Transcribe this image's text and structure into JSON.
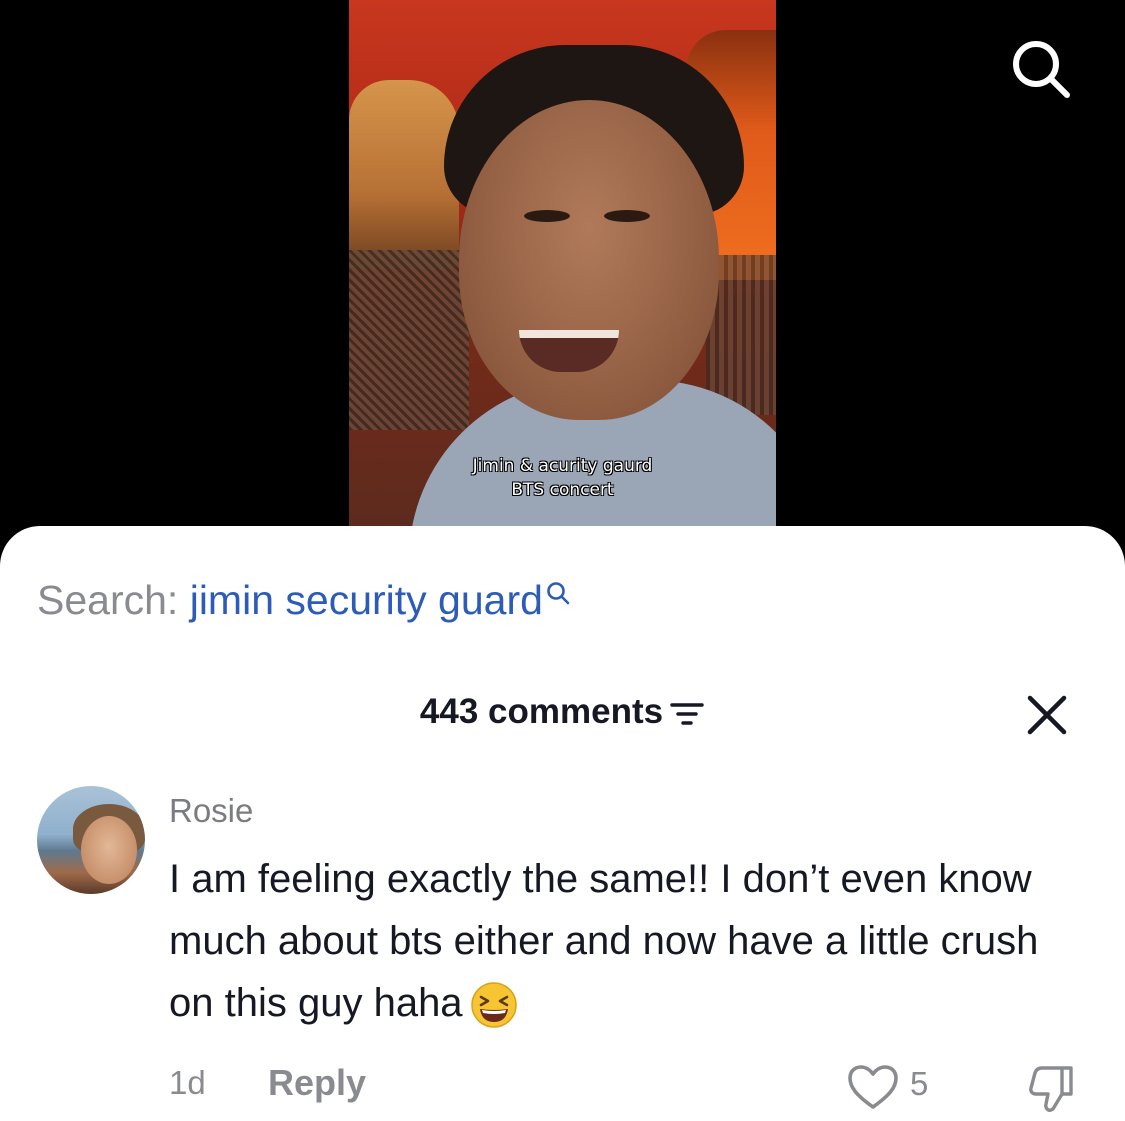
{
  "video": {
    "caption_line1": "Jimin & acurity gaurd",
    "caption_line2": "BTS concert"
  },
  "sheet": {
    "search_label": "Search:",
    "search_term": "jimin security guard",
    "comments_count_label": "443 comments"
  },
  "comment": {
    "username": "Rosie",
    "text": "I am feeling exactly the same!! I don’t even know much about bts either and now have a little crush on this guy haha",
    "emoji": "laughing-face",
    "time": "1d",
    "reply_label": "Reply",
    "likes": "5"
  },
  "icons": {
    "top_search": "search-icon",
    "inline_search": "search-icon",
    "filter": "filter-icon",
    "close": "close-icon",
    "like": "heart-icon",
    "dislike": "thumbs-down-icon"
  },
  "colors": {
    "link_blue": "#2c5bb8",
    "muted_gray": "#8a8b91",
    "text_dark": "#161823",
    "sheet_bg": "#ffffff",
    "backdrop": "#000000"
  }
}
